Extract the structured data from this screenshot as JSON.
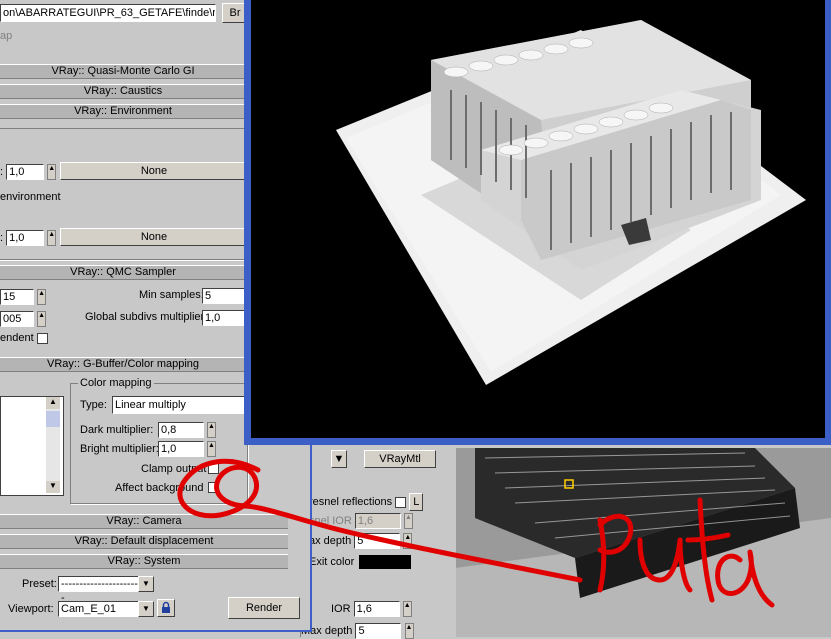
{
  "dialog": {
    "path_value": "on\\ABARRATEGUI\\PR_63_GETAFE\\finde\\r",
    "browse_label": "Br",
    "map_label": "ap",
    "rollouts": {
      "qmc_gi": "VRay:: Quasi-Monte Carlo GI",
      "caustics": "VRay:: Caustics",
      "environment": "VRay:: Environment",
      "qmc_sampler": "VRay:: QMC Sampler",
      "gbuffer": "VRay:: G-Buffer/Color mapping",
      "camera": "VRay:: Camera",
      "displacement": "VRay:: Default displacement",
      "system": "VRay:: System"
    },
    "environment": {
      "gi_multiplier": "1,0",
      "gi_map": "None",
      "refl_label": "environment",
      "refl_multiplier": "1,0",
      "refl_map": "None"
    },
    "qmc": {
      "adaptive_amount": "15",
      "min_samples_label": "Min samples:",
      "min_samples": "5",
      "noise_threshold": "005",
      "global_subdivs_label": "Global subdivs multiplier:",
      "global_subdivs": "1,0",
      "time_independent_label": "endent"
    },
    "color_mapping": {
      "group_label": "Color mapping",
      "type_label": "Type:",
      "type_value": "Linear multiply",
      "dark_label": "Dark multiplier:",
      "dark_value": "0,8",
      "bright_label": "Bright multiplier:",
      "bright_value": "1,0",
      "clamp_label": "Clamp output",
      "affect_bg_label": "Affect background"
    },
    "footer": {
      "preset_label": "Preset:",
      "preset_value": "----------------------",
      "viewport_label": "Viewport:",
      "viewport_value": "Cam_E_01",
      "render_label": "Render"
    }
  },
  "material_editor": {
    "material_type": "VRayMtl",
    "fresnel_label": "resnel reflections",
    "fresnel_ior_label": "snel IOR",
    "fresnel_ior_value": "1,6",
    "max_depth_label": "ax depth",
    "max_depth_value": "5",
    "exit_color_label": "Exit color",
    "exit_color": "#000000",
    "ior_label": "IOR",
    "ior_value": "1,6",
    "max_depth2_label": "Max depth",
    "max_depth2_value": "5",
    "l_label": "L"
  },
  "annotation": {
    "text": "Puta",
    "color": "#e00000"
  },
  "colors": {
    "frame_blue": "#3c5fc7",
    "panel_gray": "#c8c8c8",
    "rollout_gray": "#b4b4b4"
  }
}
